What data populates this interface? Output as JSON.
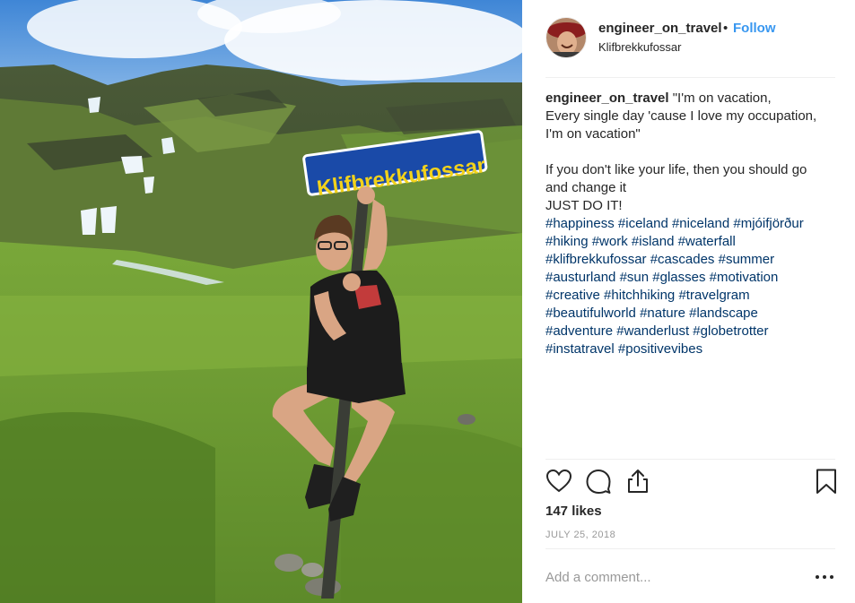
{
  "post": {
    "photo_alt": "",
    "sign_text": "Klifbrekkufossar"
  },
  "header": {
    "username": "engineer_on_travel",
    "separator": "•",
    "follow_label": "Follow",
    "location": "Klifbrekkufossar",
    "avatar_icon": "profile-avatar"
  },
  "caption": {
    "username": "engineer_on_travel",
    "lines": [
      "\"I'm on vacation,",
      "Every single day 'cause I love my occupation,",
      "I'm on vacation\"",
      "",
      "If you don't like your life, then you should go",
      "and change it",
      "JUST DO IT!"
    ],
    "hashtag_lines": [
      [
        "#happiness",
        "#iceland",
        "#niceland",
        "#mjóifjörður"
      ],
      [
        "#hiking",
        "#work",
        "#island",
        "#waterfall"
      ],
      [
        "#klifbrekkufossar",
        "#cascades",
        "#summer"
      ],
      [
        "#austurland",
        "#sun",
        "#glasses",
        "#motivation"
      ],
      [
        "#creative",
        "#hitchhiking",
        "#travelgram"
      ],
      [
        "#beautifulworld",
        "#nature",
        "#landscape"
      ],
      [
        "#adventure",
        "#wanderlust",
        "#globetrotter"
      ],
      [
        "#instatravel",
        "#positivevibes"
      ]
    ],
    "hashtag_color": "#003569"
  },
  "actions": {
    "icons": [
      "heart-icon",
      "comment-icon",
      "share-icon",
      "bookmark-icon"
    ],
    "likes": "147 likes",
    "date": "JULY 25, 2018"
  },
  "comment": {
    "placeholder": "Add a comment...",
    "more_icon": "more-options-icon"
  },
  "colors": {
    "follow": "#3897f0",
    "text": "#262626",
    "muted": "#999999",
    "divider": "#efefef",
    "sign_blue": "#1a4aa8",
    "sign_text": "#f2d21b"
  }
}
